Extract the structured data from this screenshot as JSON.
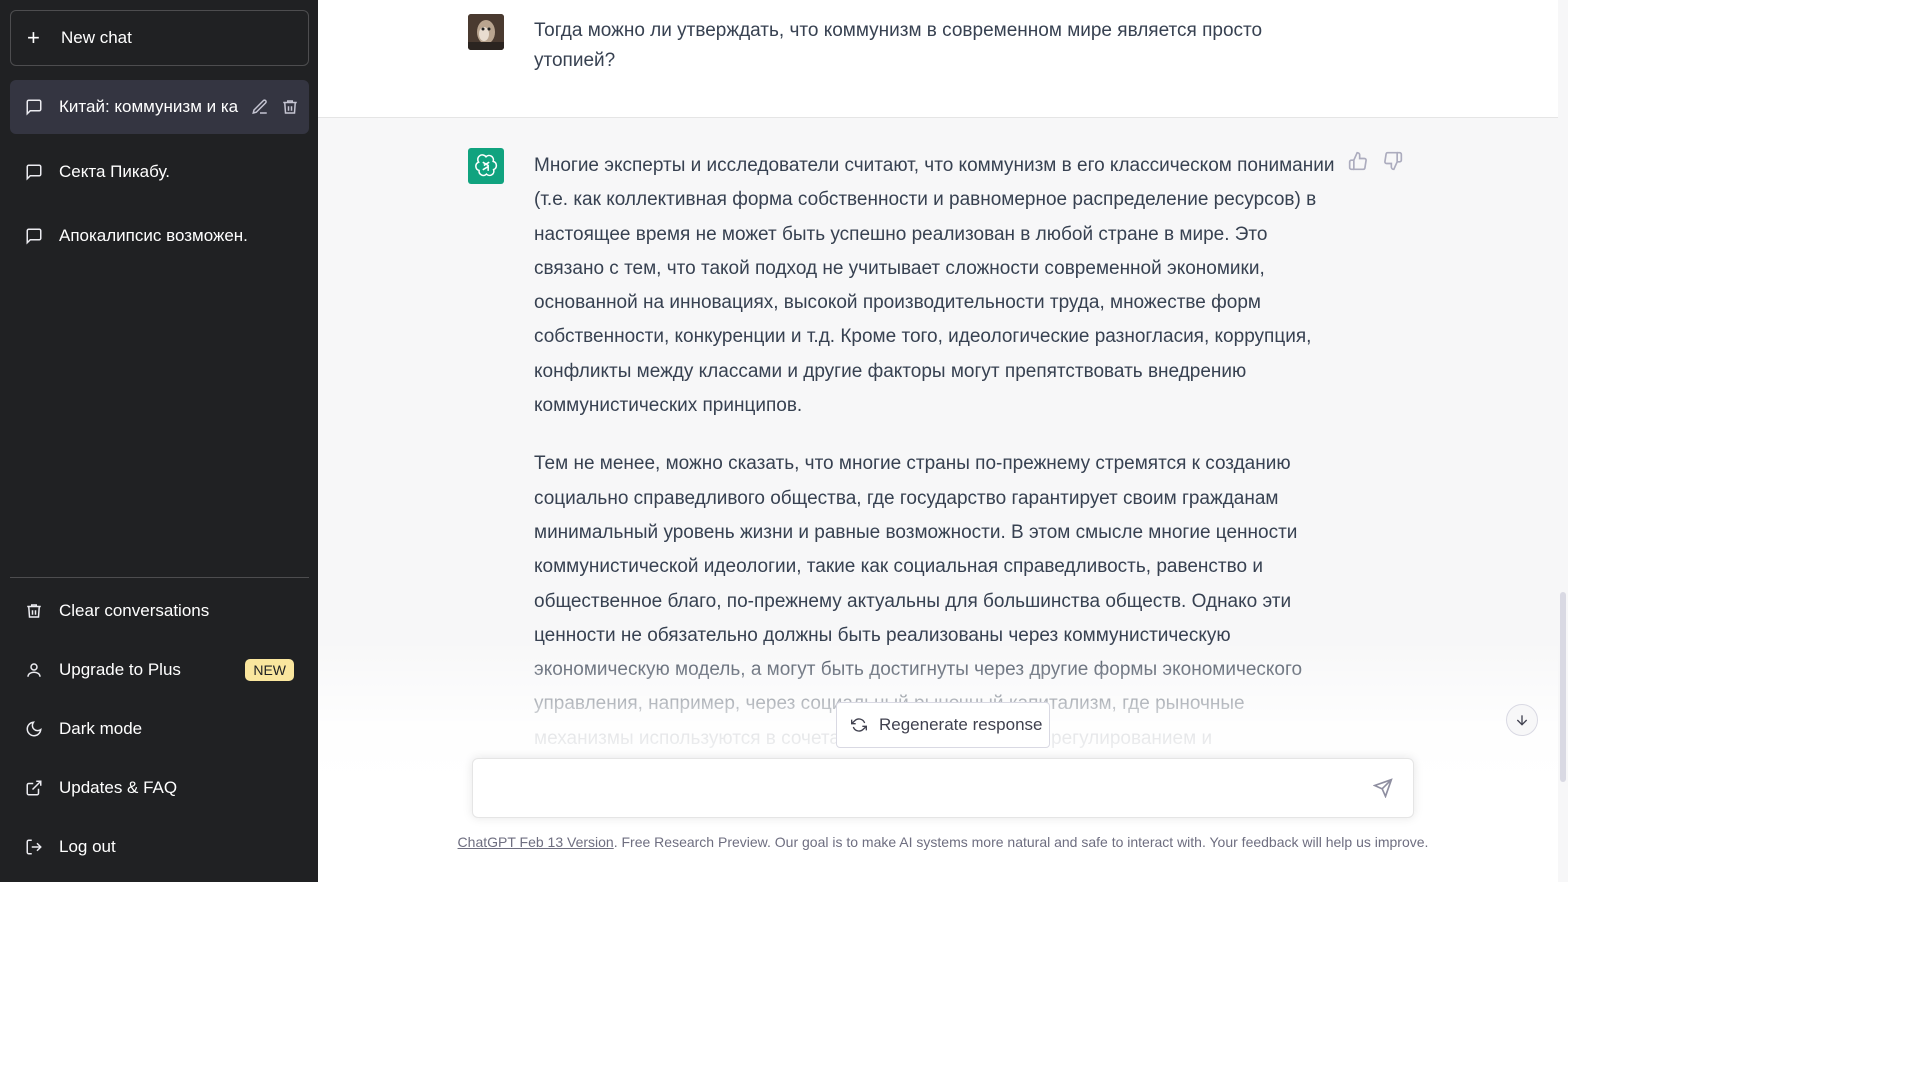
{
  "sidebar": {
    "new_chat": "New chat",
    "chats": [
      {
        "title": "Китай: коммунизм и ка",
        "active": true
      },
      {
        "title": "Секта Пикабу.",
        "active": false
      },
      {
        "title": "Апокалипсис возможен.",
        "active": false
      }
    ],
    "menu": {
      "clear": "Clear conversations",
      "upgrade": "Upgrade to Plus",
      "upgrade_badge": "NEW",
      "dark_mode": "Dark mode",
      "updates": "Updates & FAQ",
      "logout": "Log out"
    }
  },
  "conversation": {
    "user_message": "Тогда можно ли утверждать, что коммунизм в современном мире является просто утопией?",
    "bot_paragraphs": [
      "Многие эксперты и исследователи считают, что коммунизм в его классическом понимании (т.е. как коллективная форма собственности и равномерное распределение ресурсов) в настоящее время не может быть успешно реализован в любой стране в мире. Это связано с тем, что такой подход не учитывает сложности современной экономики, основанной на инновациях, высокой производительности труда, множестве форм собственности, конкуренции и т.д. Кроме того, идеологические разногласия, коррупция, конфликты между классами и другие факторы могут препятствовать внедрению коммунистических принципов.",
      "Тем не менее, можно сказать, что многие страны по-прежнему стремятся к созданию социально справедливого общества, где государство гарантирует своим гражданам минимальный уровень жизни и равные возможности. В этом смысле многие ценности коммунистической идеологии, такие как социальная справедливость, равенство и общественное благо, по-прежнему актуальны для большинства обществ. Однако эти ценности не обязательно должны быть реализованы через коммунистическую экономическую модель, а могут быть достигнуты через другие формы экономического управления, например, через социальный рыночный капитализм, где рыночные механизмы используются в сочетании с государственным регулированием и"
    ]
  },
  "regenerate_label": "Regenerate response",
  "input": {
    "placeholder": ""
  },
  "footer": {
    "version_link": "ChatGPT Feb 13 Version",
    "text": ". Free Research Preview. Our goal is to make AI systems more natural and safe to interact with. Your feedback will help us improve."
  },
  "colors": {
    "sidebar_bg": "#202123",
    "accent": "#10a37f",
    "badge": "#fae69e"
  }
}
